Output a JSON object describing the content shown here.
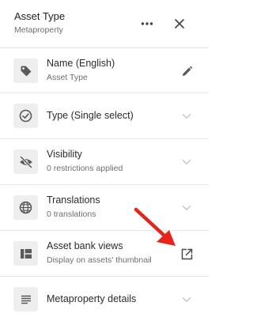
{
  "header": {
    "title": "Asset Type",
    "subtitle": "Metaproperty",
    "more_icon": "more-horizontal-icon",
    "close_icon": "close-icon"
  },
  "rows": [
    {
      "label": "Name (English)",
      "sub": "Asset Type",
      "icon": "tag-icon",
      "action_icon": "pencil-icon"
    },
    {
      "label": "Type (Single select)",
      "sub": "",
      "icon": "check-circle-icon",
      "action_icon": "chevron-down-icon"
    },
    {
      "label": "Visibility",
      "sub": "0 restrictions applied",
      "icon": "eye-off-icon",
      "action_icon": "chevron-down-icon"
    },
    {
      "label": "Translations",
      "sub": "0 translations",
      "icon": "globe-icon",
      "action_icon": "chevron-down-icon"
    },
    {
      "label": "Asset bank views",
      "sub": "Display on assets' thumbnail",
      "icon": "layout-icon",
      "action_icon": "open-in-new-icon"
    },
    {
      "label": "Metaproperty details",
      "sub": "",
      "icon": "lines-icon",
      "action_icon": "chevron-down-icon"
    }
  ],
  "colors": {
    "icon": "#5a5a5a",
    "chevron": "#c4c4c4",
    "annotation_arrow": "#e8231b"
  }
}
